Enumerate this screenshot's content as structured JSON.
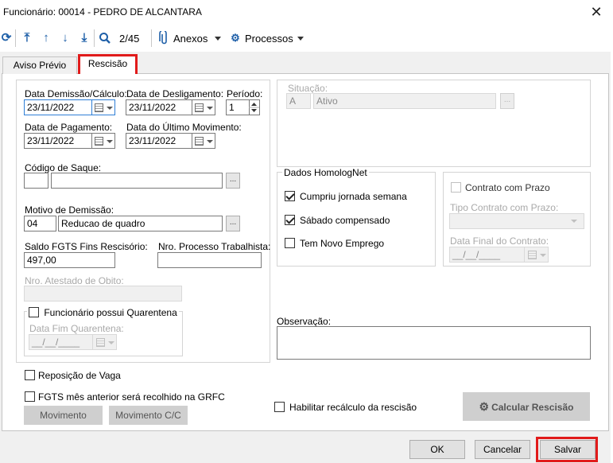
{
  "window": {
    "title": "Funcionário: 00014 - PEDRO DE ALCANTARA",
    "close_glyph": "✕"
  },
  "toolbar": {
    "record_position": "2/45",
    "attachments_label": "Anexos",
    "processes_label": "Processos"
  },
  "tabs": [
    {
      "label": "Aviso Prévio",
      "active": false
    },
    {
      "label": "Rescisão",
      "active": true
    }
  ],
  "form": {
    "data_demissao_label": "Data Demissão/Cálculo:",
    "data_demissao_value": "23/11/2022",
    "data_desligamento_label": "Data de Desligamento:",
    "data_desligamento_value": "23/11/2022",
    "periodo_label": "Período:",
    "periodo_value": "1",
    "data_pagamento_label": "Data de Pagamento:",
    "data_pagamento_value": "23/11/2022",
    "data_ultimo_mov_label": "Data do Último Movimento:",
    "data_ultimo_mov_value": "23/11/2022",
    "codigo_saque_label": "Código de Saque:",
    "codigo_saque_code": "",
    "codigo_saque_desc": "",
    "motivo_label": "Motivo de Demissão:",
    "motivo_code": "04",
    "motivo_desc": "Reducao de quadro",
    "saldo_fgts_label": "Saldo FGTS Fins Rescisório:",
    "saldo_fgts_value": "497,00",
    "nro_processo_label": "Nro. Processo Trabalhista:",
    "nro_processo_value": "",
    "nro_atestado_label": "Nro. Atestado de Obito:",
    "nro_atestado_value": "",
    "quarentena_label": "Funcionário possui Quarentena",
    "quarentena_checked": false,
    "data_fim_quarentena_label": "Data Fim Quarentena:",
    "data_fim_quarentena_value": "__/__/____",
    "ellipsis": "...",
    "date_mask": "__/__/____"
  },
  "situacao": {
    "label": "Situação:",
    "code": "A",
    "desc": "Ativo"
  },
  "homolognet": {
    "legend": "Dados HomologNet",
    "items": [
      {
        "label": "Cumpriu jornada semana",
        "checked": true
      },
      {
        "label": "Sábado compensado",
        "checked": true
      },
      {
        "label": "Tem Novo Emprego",
        "checked": false
      }
    ]
  },
  "contrato": {
    "prazo_label": "Contrato com Prazo",
    "prazo_checked": false,
    "tipo_label": "Tipo Contrato com Prazo:",
    "tipo_value": "",
    "data_final_label": "Data Final do Contrato:",
    "data_final_value": "__/__/____"
  },
  "observacao": {
    "label": "Observação:",
    "value": ""
  },
  "bottom_options": {
    "reposicao_label": "Reposição de Vaga",
    "reposicao_checked": false,
    "fgts_label": "FGTS mês anterior será recolhido na GRFC",
    "fgts_checked": false,
    "recalculo_label": "Habilitar recálculo da rescisão",
    "recalculo_checked": false,
    "movimento_label": "Movimento",
    "movimento_cc_label": "Movimento C/C",
    "calcular_label": "Calcular Rescisão"
  },
  "footer": {
    "ok_label": "OK",
    "cancel_label": "Cancelar",
    "save_label": "Salvar"
  },
  "colors": {
    "highlight": "#e11b1b",
    "toolbar_icon": "#1e5fa8",
    "focus_border": "#2f7fd6"
  }
}
